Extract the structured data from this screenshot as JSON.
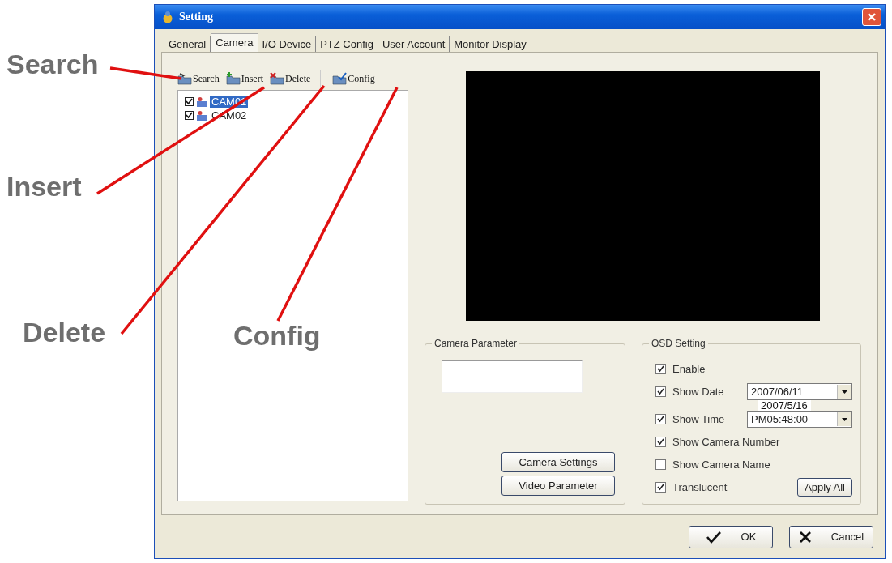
{
  "window": {
    "title": "Setting"
  },
  "tabs": [
    {
      "label": "General",
      "selected": false
    },
    {
      "label": "Camera",
      "selected": true
    },
    {
      "label": "I/O Device",
      "selected": false
    },
    {
      "label": "PTZ Config",
      "selected": false
    },
    {
      "label": "User Account",
      "selected": false
    },
    {
      "label": "Monitor Display",
      "selected": false
    }
  ],
  "toolbar": [
    {
      "label": "Search",
      "kind": "search"
    },
    {
      "label": "Insert",
      "kind": "insert"
    },
    {
      "label": "Delete",
      "kind": "delete"
    },
    {
      "label": "Config",
      "kind": "config"
    }
  ],
  "camera_list": [
    {
      "name": "CAM01",
      "checked": true,
      "selected": true
    },
    {
      "name": "CAM02",
      "checked": true,
      "selected": false
    }
  ],
  "camera_parameter": {
    "title": "Camera Parameter",
    "buttons": [
      "Camera Settings",
      "Video Parameter"
    ]
  },
  "osd_setting": {
    "title": "OSD Setting",
    "options": [
      {
        "label": "Enable",
        "checked": true,
        "kind": "check"
      },
      {
        "label": "Show Date",
        "checked": true,
        "kind": "dropdown",
        "value": "2007/06/11"
      },
      {
        "label": "Show Time",
        "checked": true,
        "kind": "dropdown",
        "value": "PM05:48:00"
      },
      {
        "label": "Show Camera Number",
        "checked": true,
        "kind": "check"
      },
      {
        "label": "Show Camera Name",
        "checked": false,
        "kind": "check"
      },
      {
        "label": "Translucent",
        "checked": true,
        "kind": "check"
      }
    ],
    "apply_button": "Apply All",
    "note": "2007/5/16"
  },
  "buttons": [
    {
      "label": "OK",
      "kind": "ok"
    },
    {
      "label": "Cancel",
      "kind": "cancel"
    }
  ],
  "annotations": [
    {
      "label": "Search"
    },
    {
      "label": "Insert"
    },
    {
      "label": "Delete"
    },
    {
      "label": "Config"
    }
  ]
}
